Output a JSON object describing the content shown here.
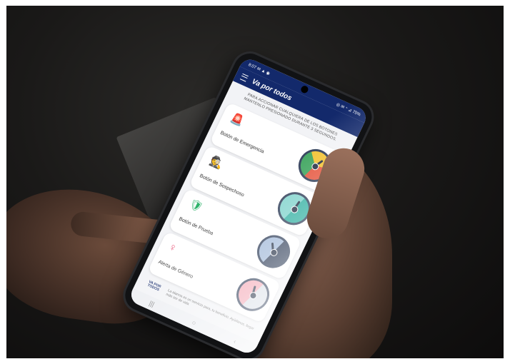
{
  "status_bar": {
    "left": "8:07 ✉ ▲ ◉",
    "right": "◎ ✉ ⁺ ⊿ 75%"
  },
  "app": {
    "title": "Va por todos"
  },
  "instructions": "PARA ACCIONAR CUALQUIERA DE LOS BOTONES MANTENLO PRESIONADO DURANTE 3 SEGUNDOS.",
  "buttons": [
    {
      "label": "Botón de Emergencia",
      "icon": "siren-icon",
      "glyph": "🚨",
      "gauge_colors": [
        "#3aa35b",
        "#f2c230",
        "#e5533b"
      ]
    },
    {
      "label": "Botón de Sospechoso",
      "icon": "spy-icon",
      "glyph": "🕵",
      "gauge_colors": [
        "#7fd3cc",
        "#2eaea0"
      ]
    },
    {
      "label": "Botón de Prueba",
      "icon": "shield-icon",
      "glyph": "🛡",
      "gauge_colors": [
        "#9fb7d8",
        "#2b3a55"
      ]
    },
    {
      "label": "Alerta de Género",
      "icon": "female-symbol-icon",
      "glyph": "♀",
      "gauge_colors": [
        "#f3a6b4",
        "#d9dfe7"
      ]
    }
  ],
  "footer": {
    "logo": "VA POR TODOS",
    "text": "La alarma es un servicio para, tu beneficio. Ayúdanos, llegar más ser de vida"
  },
  "nav_bar": {
    "recent": "|||",
    "home": "○",
    "back": "‹"
  },
  "colors": {
    "app_bar": "#13296b",
    "background": "#f2f3f6",
    "emergency": "#e53935",
    "shield": "#2fb36b",
    "gender": "#e8587a"
  }
}
